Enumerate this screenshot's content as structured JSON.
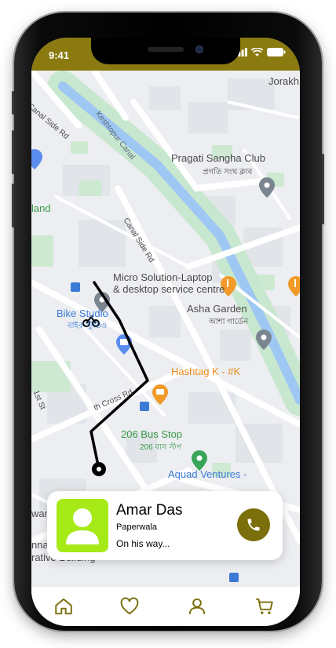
{
  "status_bar": {
    "time": "9:41"
  },
  "map": {
    "places": [
      {
        "name": "Pragati Sangha Club",
        "local": "প্রগতি সংঘ ক্লাব"
      },
      {
        "name": "Micro Solution-Laptop",
        "name2": "& desktop service centre"
      },
      {
        "name": "Bike Studio",
        "local": "বাইক স্টুডিও"
      },
      {
        "name": "Asha Garden",
        "local": "আশা গার্ডেন"
      },
      {
        "name": "Hashtag K - #K"
      },
      {
        "name": "206 Bus Stop",
        "local": "206 বাস স্টপ"
      },
      {
        "name": "Aquad Ventures -"
      }
    ],
    "areas": [
      "Jorakh",
      "land",
      "war",
      "nnagar Offic",
      "rative Building"
    ],
    "roads": [
      "Canal Side Rd",
      "Keshtopur Canal",
      "Canal Side Rd",
      "1st St",
      "th Cross Rd"
    ]
  },
  "driver_card": {
    "name": "Amar Das",
    "role": "Paperwala",
    "status": "On his way..."
  },
  "tab_bar": {
    "items": [
      "home-icon",
      "heart-icon",
      "user-icon",
      "cart-icon"
    ]
  },
  "colors": {
    "accent": "#8a7a10",
    "call_button": "#7b6f0c",
    "avatar_bg": "#a5ea17",
    "route": "#000000"
  }
}
